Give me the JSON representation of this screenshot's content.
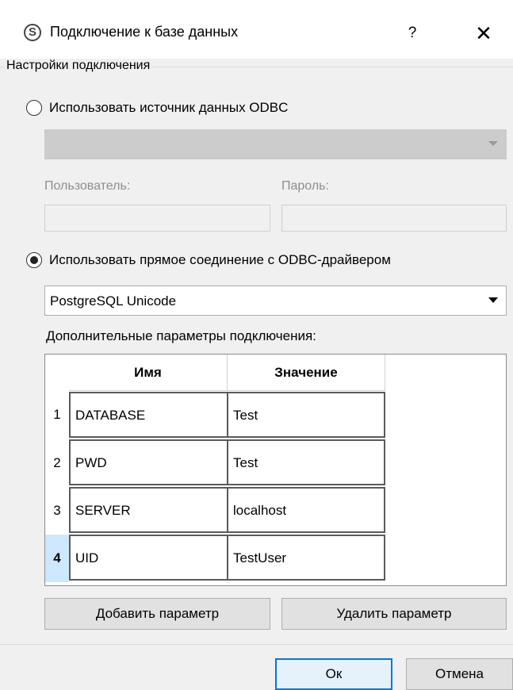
{
  "window": {
    "title": "Подключение к базе данных",
    "help_label": "?",
    "close_label": "✕"
  },
  "group": {
    "title": "Настройки подключения"
  },
  "odbc_source": {
    "radio_label": "Использовать источник данных ODBC",
    "selected": false,
    "dsn_value": "",
    "user_label": "Пользователь:",
    "user_value": "",
    "password_label": "Пароль:",
    "password_value": ""
  },
  "direct": {
    "radio_label": "Использовать прямое соединение с ODBC-драйвером",
    "selected": true,
    "driver_value": "PostgreSQL Unicode"
  },
  "params": {
    "label": "Дополнительные параметры подключения:",
    "columns": [
      "Имя",
      "Значение"
    ],
    "rows": [
      {
        "num": "1",
        "name": "DATABASE",
        "value": "Test"
      },
      {
        "num": "2",
        "name": "PWD",
        "value": "Test"
      },
      {
        "num": "3",
        "name": "SERVER",
        "value": "localhost"
      },
      {
        "num": "4",
        "name": "UID",
        "value": "TestUser"
      }
    ],
    "add_label": "Добавить параметр",
    "remove_label": "Удалить параметр"
  },
  "footer": {
    "ok_label": "Ок",
    "cancel_label": "Отмена"
  },
  "colors": {
    "accent": "#0078d7",
    "current_row": "#cde8ff"
  },
  "icons": {
    "app": "app-logo-icon",
    "radio_unchecked": "radio-unchecked-icon",
    "radio_checked": "radio-checked-icon",
    "dropdown": "chevron-down-icon"
  }
}
